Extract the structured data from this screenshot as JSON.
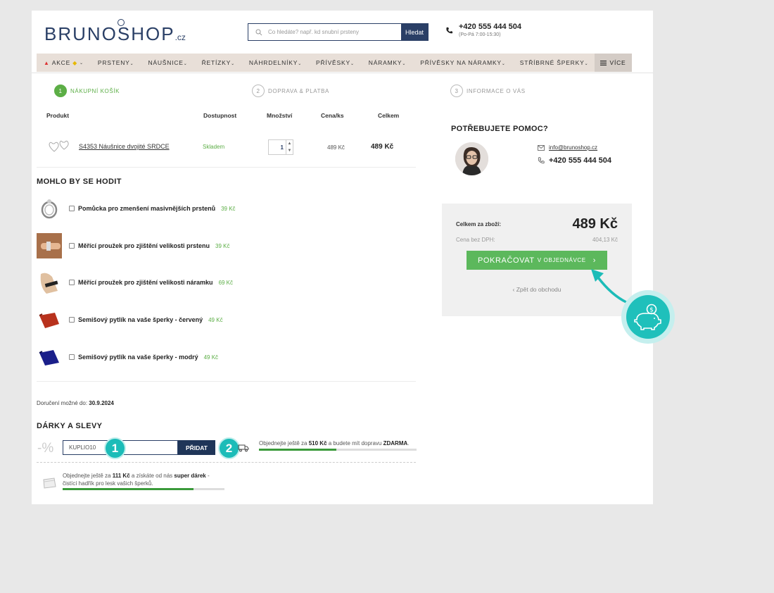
{
  "header": {
    "logo_text": "BRUNOSHOP",
    "logo_tld": ".cz",
    "search_placeholder": "Co hledáte? např. kd snubní prsteny",
    "search_button": "Hledat",
    "phone": "+420 555 444 504",
    "phone_hours": "(Po-Pá 7:00-15:30)"
  },
  "nav": {
    "items": [
      "AKCE",
      "PRSTENY",
      "NÁUŠNICE",
      "ŘETÍZKY",
      "NÁHRDELNÍKY",
      "PŘÍVĚSKY",
      "NÁRAMKY",
      "PŘÍVĚSKY NA NÁRAMKY",
      "STŘÍBRNÉ ŠPERKY"
    ],
    "more": "VÍCE"
  },
  "steps": [
    {
      "num": "1",
      "label": "NÁKUPNÍ KOŠÍK"
    },
    {
      "num": "2",
      "label": "DOPRAVA & PLATBA"
    },
    {
      "num": "3",
      "label": "INFORMACE O VÁS"
    }
  ],
  "table": {
    "headers": {
      "product": "Produkt",
      "availability": "Dostupnost",
      "quantity": "Množství",
      "unit_price": "Cena/ks",
      "total": "Celkem"
    },
    "row": {
      "name": "S4353 Náušnice dvojité SRDCE",
      "availability": "Skladem",
      "quantity": "1",
      "unit_price": "489 Kč",
      "total": "489 Kč"
    }
  },
  "suggestions": {
    "title": "MOHLO BY SE HODIT",
    "items": [
      {
        "name": "Pomůcka pro zmenšení masivnějších prstenů",
        "price": "39 Kč"
      },
      {
        "name": "Měřící proužek pro zjištění velikosti prstenu",
        "price": "39 Kč"
      },
      {
        "name": "Měřící proužek pro zjištění velikosti náramku",
        "price": "69 Kč"
      },
      {
        "name": "Semišový pytlík na vaše šperky - červený",
        "price": "49 Kč"
      },
      {
        "name": "Semišový pytlík na vaše šperky - modrý",
        "price": "49 Kč"
      }
    ]
  },
  "delivery": {
    "label": "Doručení možné do:",
    "date": "30.9.2024"
  },
  "gifts": {
    "title": "DÁRKY A SLEVY",
    "percent_symbol": "-%",
    "coupon_value": "KUPLIO10",
    "add_button": "PŘIDAT",
    "badge_1": "1",
    "badge_2": "2",
    "shipping_pre": "Objednejte ještě za",
    "shipping_amount": "510 Kč",
    "shipping_mid": "a budete mít dopravu",
    "shipping_free": "ZDARMA",
    "shipping_end": ".",
    "shipping_progress": 0.49,
    "gift_pre": "Objednejte ještě za",
    "gift_amount": "111 Kč",
    "gift_mid": "a získáte od nás",
    "gift_strong": "super dárek",
    "gift_end": "- čistící hadřík pro lesk vašich šperků.",
    "gift_progress": 0.81
  },
  "help": {
    "title": "POTŘEBUJETE POMOC?",
    "email": "info@brunoshop.cz",
    "phone": "+420 555 444 504"
  },
  "summary": {
    "total_label": "Celkem za zboží:",
    "total_value": "489 Kč",
    "net_label": "Cena bez DPH:",
    "net_value": "404,13 Kč",
    "continue_main": "POKRAČOVAT",
    "continue_small": "V OBJEDNÁVCE",
    "back": "Zpět do obchodu"
  },
  "colors": {
    "brand": "#2a3f66",
    "green": "#5cae46",
    "teal": "#1cbcb8",
    "nav_bg": "#e8dfd8"
  }
}
